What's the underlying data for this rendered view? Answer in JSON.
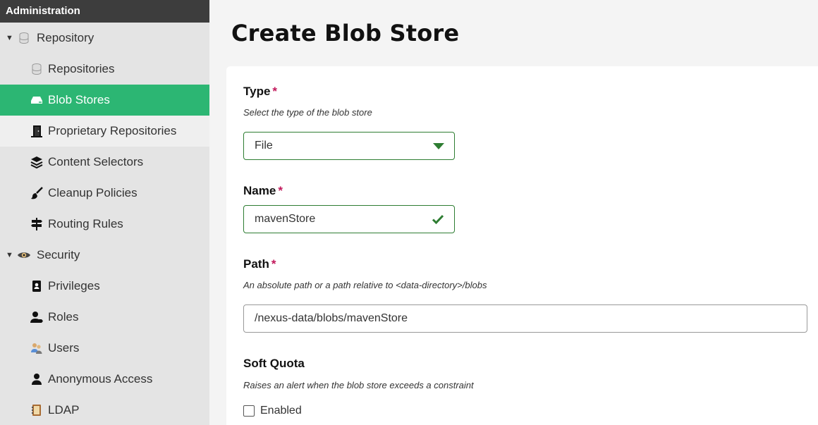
{
  "sidebar": {
    "header": "Administration",
    "repository_group": "Repository",
    "repository_items": [
      "Repositories",
      "Blob Stores",
      "Proprietary Repositories",
      "Content Selectors",
      "Cleanup Policies",
      "Routing Rules"
    ],
    "security_group": "Security",
    "security_items": [
      "Privileges",
      "Roles",
      "Users",
      "Anonymous Access",
      "LDAP"
    ]
  },
  "page": {
    "title": "Create Blob Store"
  },
  "form": {
    "type": {
      "label": "Type",
      "required": "*",
      "help": "Select the type of the blob store",
      "value": "File"
    },
    "name": {
      "label": "Name",
      "required": "*",
      "value": "mavenStore"
    },
    "path": {
      "label": "Path",
      "required": "*",
      "help": "An absolute path or a path relative to <data-directory>/blobs",
      "value": "/nexus-data/blobs/mavenStore"
    },
    "soft_quota": {
      "label": "Soft Quota",
      "help": "Raises an alert when the blob store exceeds a constraint",
      "checkbox_label": "Enabled"
    }
  },
  "colors": {
    "selected": "#2cb673",
    "valid": "#2e7d32",
    "required": "#c2185b"
  }
}
